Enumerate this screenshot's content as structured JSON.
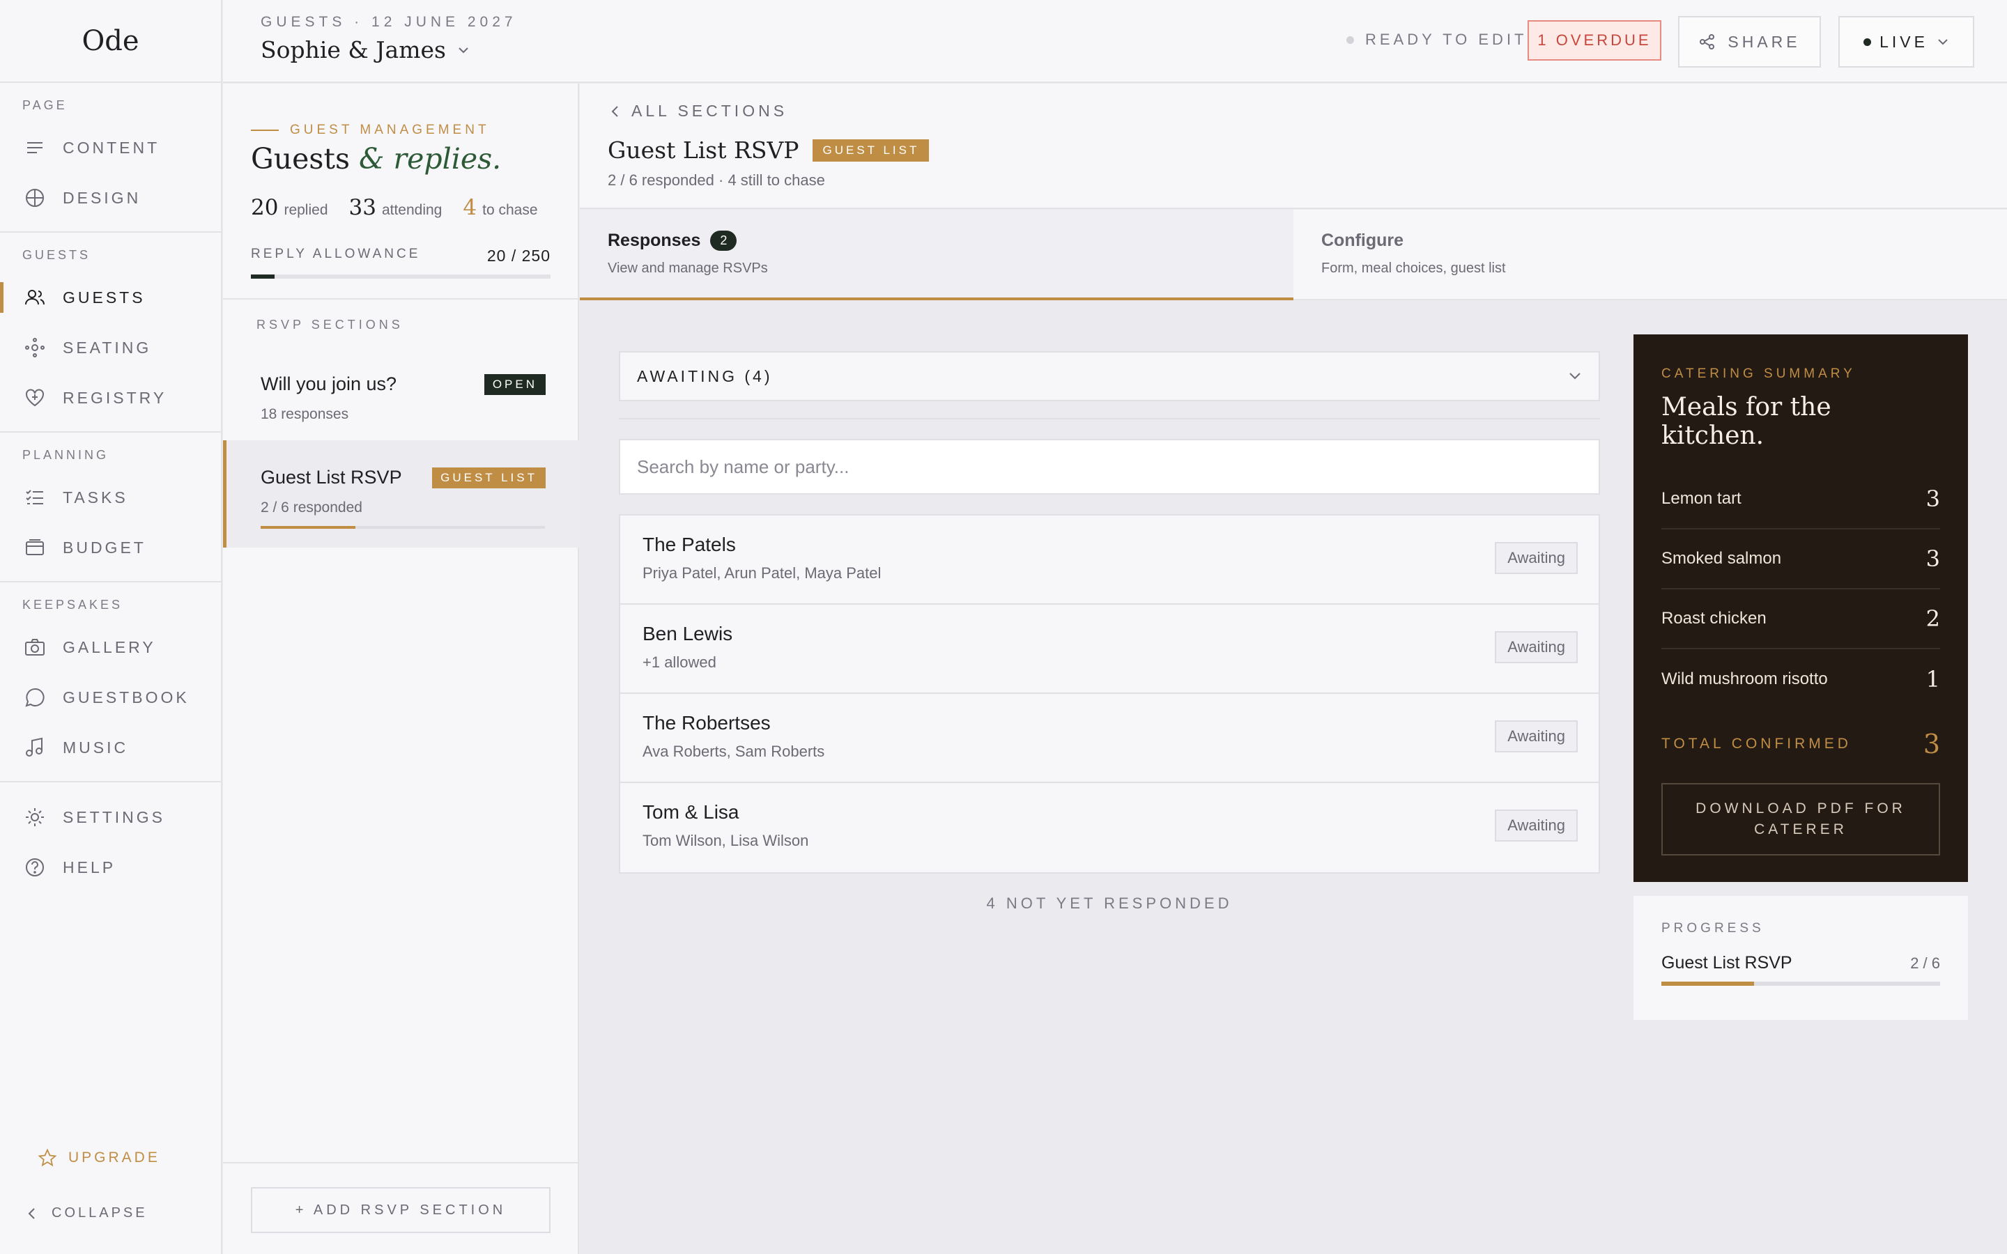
{
  "brand": {
    "logo": "Ode"
  },
  "nav": {
    "groups": [
      {
        "label": "PAGE",
        "items": [
          {
            "label": "CONTENT",
            "icon": "lines-icon"
          },
          {
            "label": "DESIGN",
            "icon": "globe-icon"
          }
        ]
      },
      {
        "label": "GUESTS",
        "items": [
          {
            "label": "GUESTS",
            "icon": "people-icon",
            "active": true
          },
          {
            "label": "SEATING",
            "icon": "seating-icon"
          },
          {
            "label": "REGISTRY",
            "icon": "heart-icon"
          }
        ]
      },
      {
        "label": "PLANNING",
        "items": [
          {
            "label": "TASKS",
            "icon": "checklist-icon"
          },
          {
            "label": "BUDGET",
            "icon": "wallet-icon"
          }
        ]
      },
      {
        "label": "KEEPSAKES",
        "items": [
          {
            "label": "GALLERY",
            "icon": "camera-icon"
          },
          {
            "label": "GUESTBOOK",
            "icon": "chat-icon"
          },
          {
            "label": "MUSIC",
            "icon": "music-icon"
          }
        ]
      }
    ],
    "settings": "SETTINGS",
    "help": "HELP",
    "upgrade": "UPGRADE",
    "collapse": "COLLAPSE"
  },
  "topbar": {
    "crumb": "GUESTS · 12 JUNE 2027",
    "couple": "Sophie & James",
    "ready": "READY TO EDIT",
    "overdue": "1 OVERDUE",
    "share": "SHARE",
    "live": "LIVE"
  },
  "side": {
    "eyebrow": "GUEST MANAGEMENT",
    "title_a": "Guests ",
    "title_amp": "& replies.",
    "stats": [
      {
        "n": "20",
        "l": "replied"
      },
      {
        "n": "33",
        "l": "attending"
      },
      {
        "n": "4",
        "l": "to chase"
      }
    ],
    "allowance_label": "REPLY ALLOWANCE",
    "allowance_value": "20 / 250",
    "allowance_fraction": 0.08,
    "sections_label": "RSVP SECTIONS",
    "sections": [
      {
        "name": "Will you join us?",
        "badge": "OPEN",
        "sub": "18 responses"
      },
      {
        "name": "Guest List RSVP",
        "badge": "GUEST LIST",
        "sub": "2 / 6 responded",
        "progress": 0.333
      }
    ],
    "add_section": "+ ADD RSVP SECTION"
  },
  "main": {
    "back": "ALL SECTIONS",
    "title": "Guest List RSVP",
    "badge": "GUEST LIST",
    "subtitle": "2 / 6 responded · 4 still to chase",
    "tabs": [
      {
        "title": "Responses",
        "count": "2",
        "sub": "View and manage RSVPs"
      },
      {
        "title": "Configure",
        "sub": "Form, meal choices, guest list"
      }
    ],
    "filter": "AWAITING (4)",
    "search_placeholder": "Search by name or party...",
    "guests": [
      {
        "name": "The Patels",
        "meta": "Priya Patel, Arun Patel, Maya Patel",
        "status": "Awaiting"
      },
      {
        "name": "Ben Lewis",
        "meta": "+1 allowed",
        "status": "Awaiting"
      },
      {
        "name": "The Robertses",
        "meta": "Ava Roberts, Sam Roberts",
        "status": "Awaiting"
      },
      {
        "name": "Tom & Lisa",
        "meta": "Tom Wilson, Lisa Wilson",
        "status": "Awaiting"
      }
    ],
    "not_yet": "4 NOT YET RESPONDED"
  },
  "catering": {
    "label": "CATERING SUMMARY",
    "title": "Meals for the kitchen.",
    "meals": [
      {
        "name": "Lemon tart",
        "qty": "3"
      },
      {
        "name": "Smoked salmon",
        "qty": "3"
      },
      {
        "name": "Roast chicken",
        "qty": "2"
      },
      {
        "name": "Wild mushroom risotto",
        "qty": "1"
      }
    ],
    "total_label": "TOTAL CONFIRMED",
    "total": "3",
    "download": "DOWNLOAD PDF FOR CATERER"
  },
  "progress": {
    "label": "PROGRESS",
    "name": "Guest List RSVP",
    "value": "2 / 6",
    "fraction": 0.333
  },
  "colors": {
    "accent": "#c08d45",
    "dark": "#241a14",
    "badge_dark": "#1f2a22",
    "danger": "#c8473b"
  }
}
